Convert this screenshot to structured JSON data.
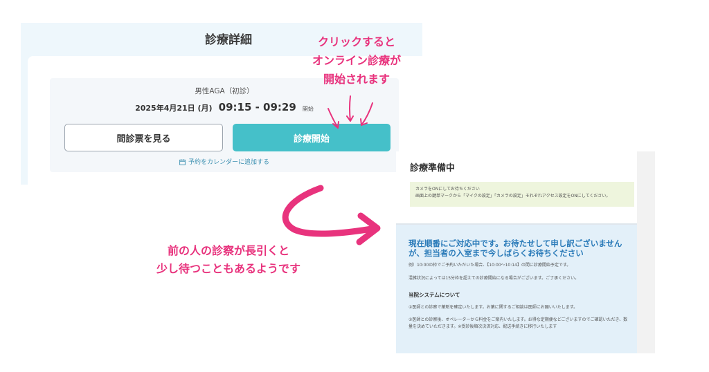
{
  "panel1": {
    "title": "診療詳細",
    "plan_name": "男性AGA（初診）",
    "date": "2025年4月21日 (月)",
    "time_range": "09:15 - 09:29",
    "start_suffix": "開始",
    "questionnaire_button": "問診票を見る",
    "start_button": "診療開始",
    "calendar_link": "予約をカレンダーに追加する",
    "accent_color": "#45c0c9"
  },
  "annotations": {
    "top_lines": [
      "クリックすると",
      "オンライン診療が",
      "開始されます"
    ],
    "bottom_lines": [
      "前の人の診察が長引くと",
      "少し待つこともあるようです"
    ],
    "color": "#e8337d"
  },
  "panel2": {
    "title": "診療準備中",
    "notice_lines": [
      "カメラをONにしてお待ちください",
      "画面上の鍵単マークから「マイクの設定」「カメラの設定」それぞれアクセス設定をONにしてください。"
    ],
    "heading": "現在順番にご対応中です。お待たせして申し訳ございませんが、担当者の入室まで今しばらくお待ちください",
    "example_text": "例）10:00の枠でご予約いただいた場合、【10:00〜10:14】の間に診療開始予定です。",
    "delay_text": "混雑状況によっては15分枠を超えての診療開始になる場合がございます。ご了承ください。",
    "system_heading": "当院システムについて",
    "system_items": [
      "①医師との診察で薬剤を確定いたします。お薬に関するご相談は医師にお願いいたします。",
      "②医師との診察後、オペレーターから料金をご案内いたします。お得な定期便などございますのでご確認いただき、数量を決めていただきます。※受診後順次決済対応、配送手続きに移行いたします"
    ],
    "heading_color": "#2b7bb9"
  }
}
